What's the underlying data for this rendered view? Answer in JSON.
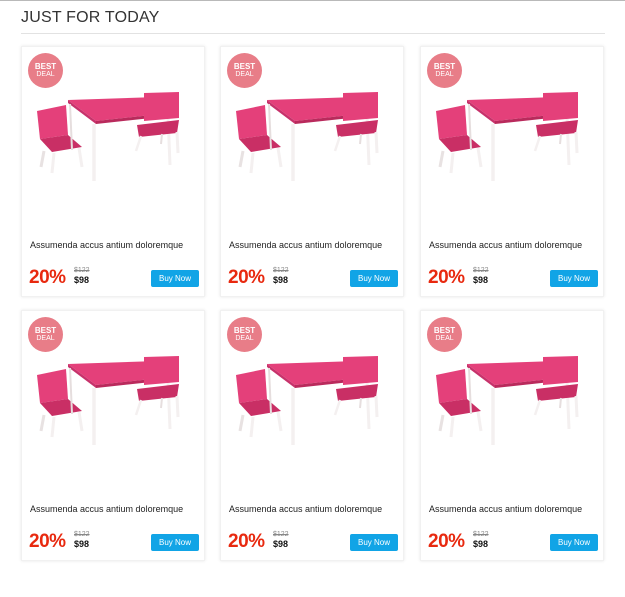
{
  "section": {
    "title": "JUST FOR TODAY"
  },
  "products": [
    {
      "badge_line1": "BEST",
      "badge_line2": "DEAL",
      "name": "Assumenda accus antium doloremque",
      "discount": "20%",
      "old_price": "$122",
      "new_price": "$98",
      "buy_label": "Buy Now"
    },
    {
      "badge_line1": "BEST",
      "badge_line2": "DEAL",
      "name": "Assumenda accus antium doloremque",
      "discount": "20%",
      "old_price": "$122",
      "new_price": "$98",
      "buy_label": "Buy Now"
    },
    {
      "badge_line1": "BEST",
      "badge_line2": "DEAL",
      "name": "Assumenda accus antium doloremque",
      "discount": "20%",
      "old_price": "$122",
      "new_price": "$98",
      "buy_label": "Buy Now"
    },
    {
      "badge_line1": "BEST",
      "badge_line2": "DEAL",
      "name": "Assumenda accus antium doloremque",
      "discount": "20%",
      "old_price": "$122",
      "new_price": "$98",
      "buy_label": "Buy Now"
    },
    {
      "badge_line1": "BEST",
      "badge_line2": "DEAL",
      "name": "Assumenda accus antium doloremque",
      "discount": "20%",
      "old_price": "$122",
      "new_price": "$98",
      "buy_label": "Buy Now"
    },
    {
      "badge_line1": "BEST",
      "badge_line2": "DEAL",
      "name": "Assumenda accus antium doloremque",
      "discount": "20%",
      "old_price": "$122",
      "new_price": "$98",
      "buy_label": "Buy Now"
    }
  ],
  "colors": {
    "badge": "#e87d88",
    "discount": "#e8290f",
    "buy_button": "#11a4e6",
    "furniture": "#e4407a"
  },
  "icons": {
    "badge": "best-deal-badge",
    "product_image": "pink-kids-table-and-chairs"
  }
}
